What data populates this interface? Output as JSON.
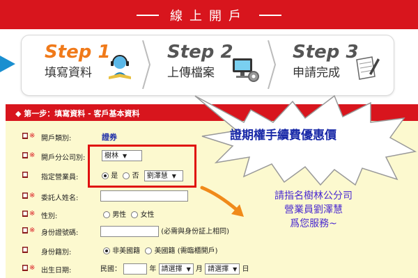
{
  "header": {
    "title": "線上開戶"
  },
  "steps": [
    {
      "title": "Step 1",
      "subtitle": "填寫資料",
      "color": "#f07a1a",
      "icon": "student-reading-icon"
    },
    {
      "title": "Step 2",
      "subtitle": "上傳檔案",
      "color": "#555555",
      "icon": "computer-gear-icon"
    },
    {
      "title": "Step 3",
      "subtitle": "申請完成",
      "color": "#555555",
      "icon": "document-pen-icon"
    }
  ],
  "form": {
    "section_title": "◆ 第一步：填寫資料 - 客戶基本資料",
    "req_mark": "※",
    "mark_glyph": "■",
    "rows": {
      "account_type": {
        "label": "開戶類別:",
        "value": "證券"
      },
      "branch": {
        "label": "開戶分公司別:",
        "selected": "樹林"
      },
      "agent": {
        "label": "指定營業員:",
        "yes": "是",
        "no": "否",
        "selected": "劉澤慧"
      },
      "name": {
        "label": "委託人姓名:"
      },
      "gender": {
        "label": "性別:",
        "male": "男性",
        "female": "女性"
      },
      "id_number": {
        "label": "身份證號碼:",
        "note": "(必需與身份証上相同)"
      },
      "nationality": {
        "label": "身份籍別:",
        "non_us": "非美國籍",
        "us": "美國籍",
        "us_note": "(需臨櫃開戶)"
      },
      "birthday": {
        "label": "出生日期:",
        "era": "民國：",
        "year": "年",
        "month_select": "請選擇",
        "month": "月",
        "day_select": "請選擇",
        "day": "日"
      }
    }
  },
  "callout": {
    "text": "證期權手續費優惠價"
  },
  "promo": {
    "line1": "請指名樹林公分司",
    "line2": "營業員劉澤慧",
    "line3": "爲您服務~"
  },
  "colors": {
    "brand_red": "#d8151d",
    "form_bg": "#fcf9cf",
    "highlight": "#e01010",
    "promo_text": "#4a2ad0",
    "callout_text": "#1a2aa8"
  }
}
